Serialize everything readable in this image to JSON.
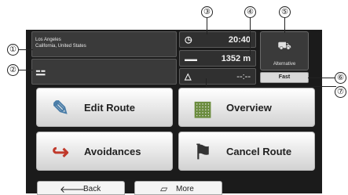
{
  "location": {
    "line1": "Los Angeles",
    "line2": "California, United States"
  },
  "road_sign": "⚍",
  "info": {
    "arrival_time": "20:40",
    "distance": "1352 m",
    "delay": "--:--",
    "clock_icon": "clock-icon",
    "distance_icon": "distance-icon",
    "traffic_icon": "traffic-warning-icon"
  },
  "route_options": {
    "alternative_label": "Alternative",
    "fast_label": "Fast"
  },
  "buttons": {
    "edit_route": "Edit Route",
    "overview": "Overview",
    "avoidances": "Avoidances",
    "cancel_route": "Cancel Route"
  },
  "tabs": {
    "back": "Back",
    "more": "More"
  },
  "callouts": [
    "①",
    "②",
    "③",
    "④",
    "⑤",
    "⑥",
    "⑦"
  ]
}
